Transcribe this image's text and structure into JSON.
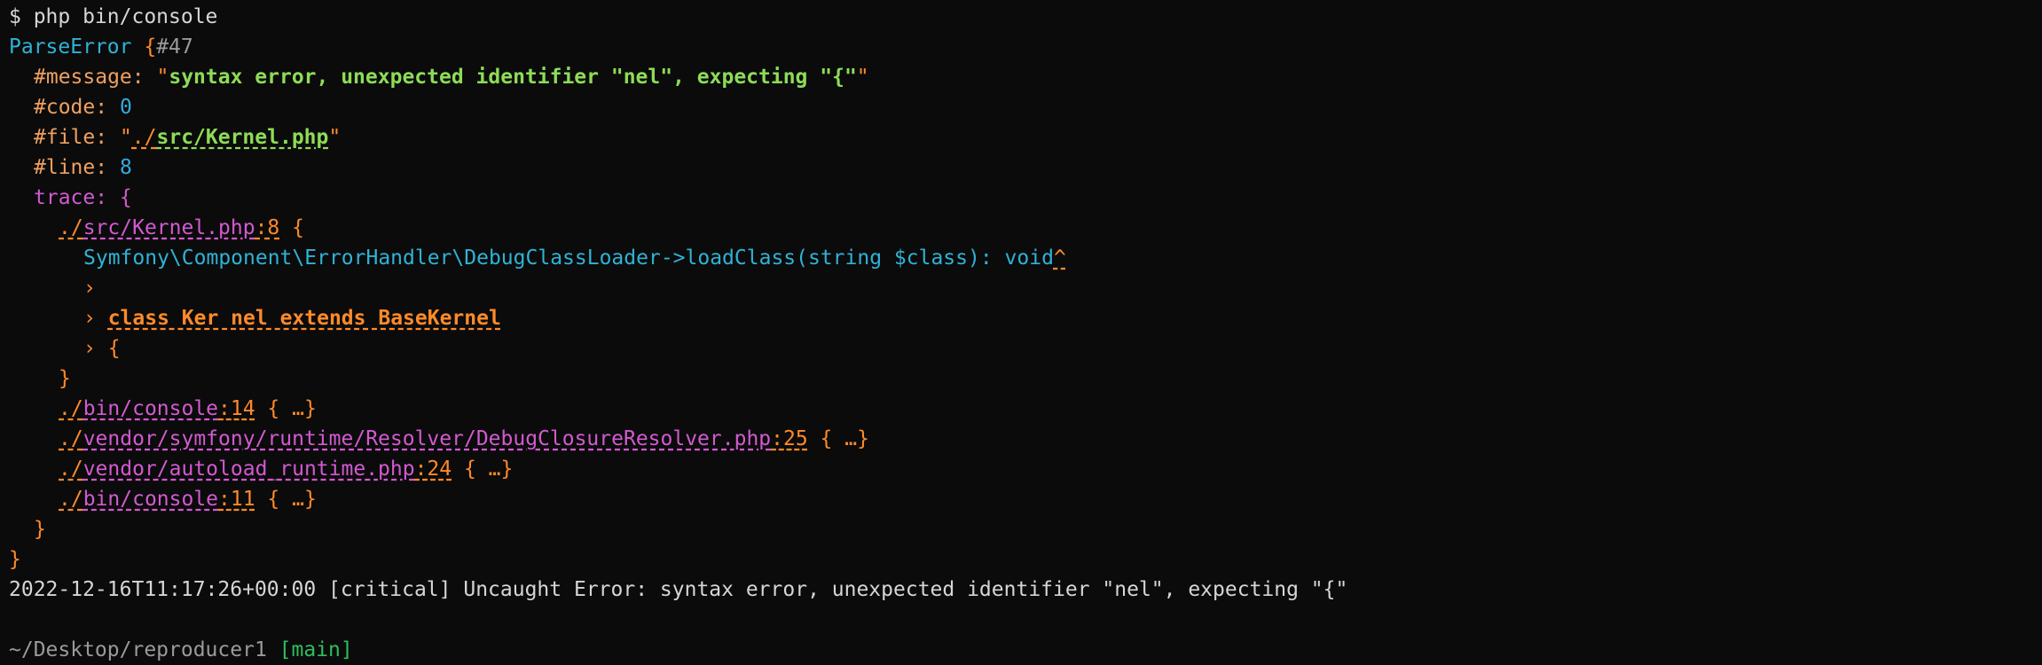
{
  "prompt": "$ php bin/console",
  "error": {
    "class": "ParseError",
    "brace_open": " {",
    "id": "#47",
    "message_key": "#message: ",
    "message_q1": "\"",
    "message_value": "syntax error, unexpected identifier \"nel\", expecting \"{\"",
    "message_q2": "\"",
    "code_key": "#code: ",
    "code_value": "0",
    "file_key": "#file: ",
    "file_q1": "\"",
    "file_dir": "./",
    "file_path": "src/Kernel.php",
    "file_q2": "\"",
    "line_key": "#line: ",
    "line_value": "8",
    "trace_key": "trace: {"
  },
  "trace": {
    "frame1_dir": "./",
    "frame1_path": "src/Kernel.php",
    "frame1_line": ":8",
    "frame1_brace": " {",
    "call": "Symfony\\Component\\ErrorHandler\\DebugClassLoader->loadClass(string $class): void",
    "caret": "^",
    "code_line1": "›",
    "code_line2_marker": "› ",
    "code_line2": "class Ker nel extends BaseKernel",
    "code_line3": "› {",
    "frame1_close": "}",
    "frames": [
      {
        "dir": "./",
        "path": "bin/console",
        "line": ":14",
        "rest": " { …}"
      },
      {
        "dir": "./",
        "path": "vendor/symfony/runtime/Resolver/DebugClosureResolver.php",
        "line": ":25",
        "rest": " { …}"
      },
      {
        "dir": "./",
        "path": "vendor/autoload_runtime.php",
        "line": ":24",
        "rest": " { …}"
      },
      {
        "dir": "./",
        "path": "bin/console",
        "line": ":11",
        "rest": " { …}"
      }
    ],
    "trace_close": "}",
    "error_close": "}"
  },
  "log_line": "2022-12-16T11:17:26+00:00 [critical] Uncaught Error: syntax error, unexpected identifier \"nel\", expecting \"{\"",
  "shell_prompt": {
    "path": "~/Desktop/reproducer1",
    "branch": " [main]"
  }
}
